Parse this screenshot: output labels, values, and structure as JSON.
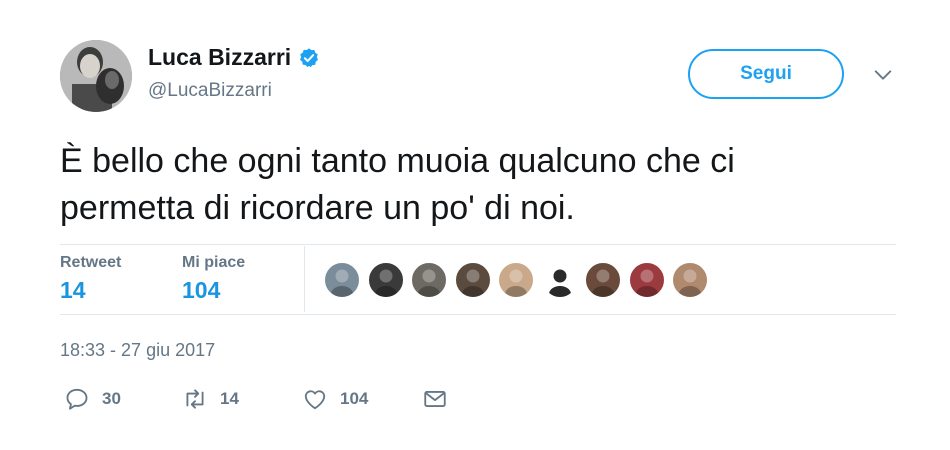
{
  "author": {
    "name": "Luca Bizzarri",
    "handle": "@LucaBizzarri",
    "verified_icon": "verified-badge-icon",
    "avatar_icon": "avatar"
  },
  "follow_button": {
    "label": "Segui"
  },
  "tweet": {
    "text_line1": "È bello che ogni tanto muoia qualcuno che ci",
    "text_line2": "permetta di ricordare un po' di noi."
  },
  "stats": {
    "retweet_label": "Retweet",
    "retweet_value": "14",
    "likes_label": "Mi piace",
    "likes_value": "104"
  },
  "likers": [
    {
      "color": "#7b8c9a"
    },
    {
      "color": "#3a3a3a"
    },
    {
      "color": "#6d6a63"
    },
    {
      "color": "#5b4b3f"
    },
    {
      "color": "#c9a98a"
    },
    {
      "color": "#ffffff"
    },
    {
      "color": "#6a4a3a"
    },
    {
      "color": "#9b3a3f"
    },
    {
      "color": "#b08a6f"
    }
  ],
  "timestamp": "18:33 - 27 giu 2017",
  "actions": {
    "reply_count": "30",
    "retweet_count": "14",
    "like_count": "104"
  },
  "colors": {
    "accent": "#1da1f2",
    "link": "#1b95e0",
    "muted": "#657786",
    "divider": "#e1e8ed"
  }
}
